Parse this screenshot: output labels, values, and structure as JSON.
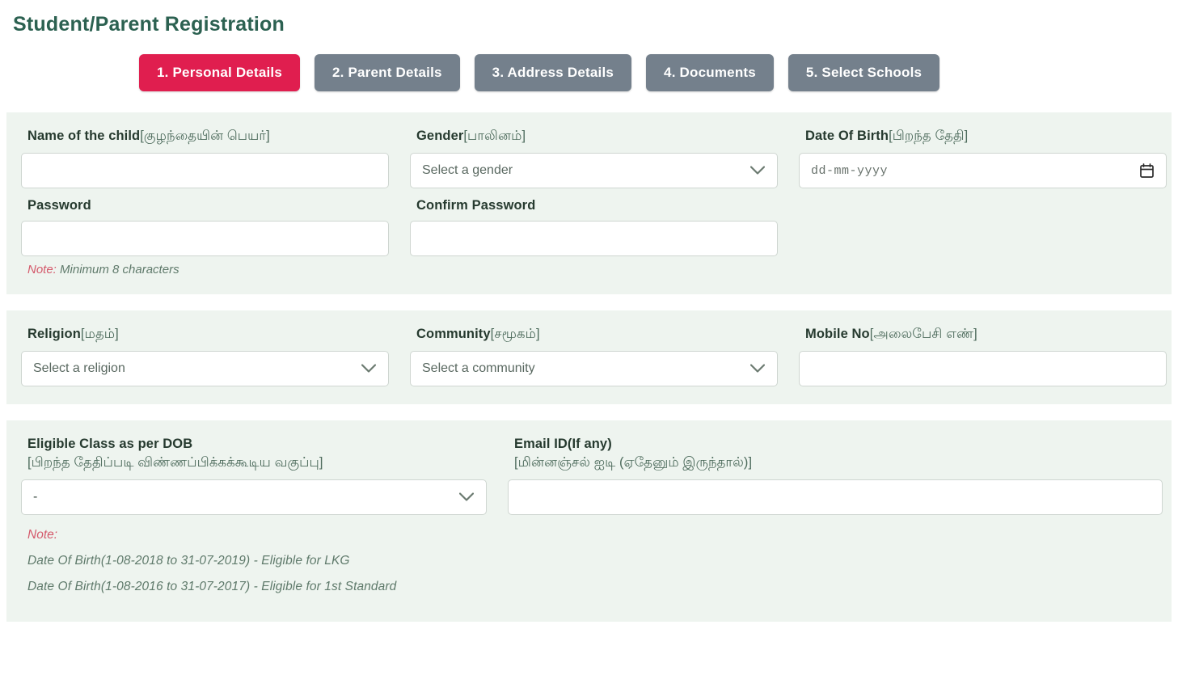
{
  "page": {
    "title": "Student/Parent Registration",
    "title_color": "#2c6151",
    "panel_bg": "#eef4ef"
  },
  "tabs": {
    "active_color": "#e01e4f",
    "inactive_color": "#74808c",
    "items": [
      {
        "label": "1. Personal Details",
        "state": "active"
      },
      {
        "label": "2. Parent Details",
        "state": "inactive"
      },
      {
        "label": "3. Address Details",
        "state": "inactive"
      },
      {
        "label": "4. Documents",
        "state": "inactive"
      },
      {
        "label": "5. Select Schools",
        "state": "inactive"
      }
    ]
  },
  "personal": {
    "child_name": {
      "label_en": "Name of the child",
      "label_ta": "[குழந்தையின் பெயர்]",
      "value": ""
    },
    "gender": {
      "label_en": "Gender",
      "label_ta": "[பாலினம்]",
      "selected": "Select a gender",
      "icon": "chevron-down-icon"
    },
    "dob": {
      "label_en": "Date Of Birth",
      "label_ta": "[பிறந்த தேதி]",
      "placeholder": "dd-mm-yyyy",
      "value": "",
      "icon": "calendar-icon"
    },
    "password": {
      "label_en": "Password",
      "value": "",
      "note_keyword": "Note:",
      "note_text": " Minimum 8 characters"
    },
    "confirm_password": {
      "label_en": "Confirm Password",
      "value": ""
    }
  },
  "demographics": {
    "religion": {
      "label_en": "Religion",
      "label_ta": "[மதம்]",
      "selected": "Select a religion",
      "icon": "chevron-down-icon"
    },
    "community": {
      "label_en": "Community",
      "label_ta": "[சமூகம்]",
      "selected": "Select a community",
      "icon": "chevron-down-icon"
    },
    "mobile": {
      "label_en": "Mobile No",
      "label_ta": "[அலைபேசி எண்]",
      "value": ""
    }
  },
  "eligibility": {
    "eligible_class": {
      "label_en": "Eligible Class as per DOB",
      "label_ta": "[பிறந்த தேதிப்படி விண்ணப்பிக்கக்கூடிய வகுப்பு]",
      "selected": "-",
      "icon": "chevron-down-icon"
    },
    "email": {
      "label_en": "Email ID(If any)",
      "label_ta": "[மின்னஞ்சல் ஐடி (ஏதேனும் இருந்தால்)]",
      "value": ""
    },
    "note_head": "Note:",
    "note_lines": [
      "Date Of Birth(1-08-2018 to 31-07-2019) - Eligible for LKG",
      "Date Of Birth(1-08-2016 to 31-07-2017) - Eligible for 1st Standard"
    ]
  }
}
